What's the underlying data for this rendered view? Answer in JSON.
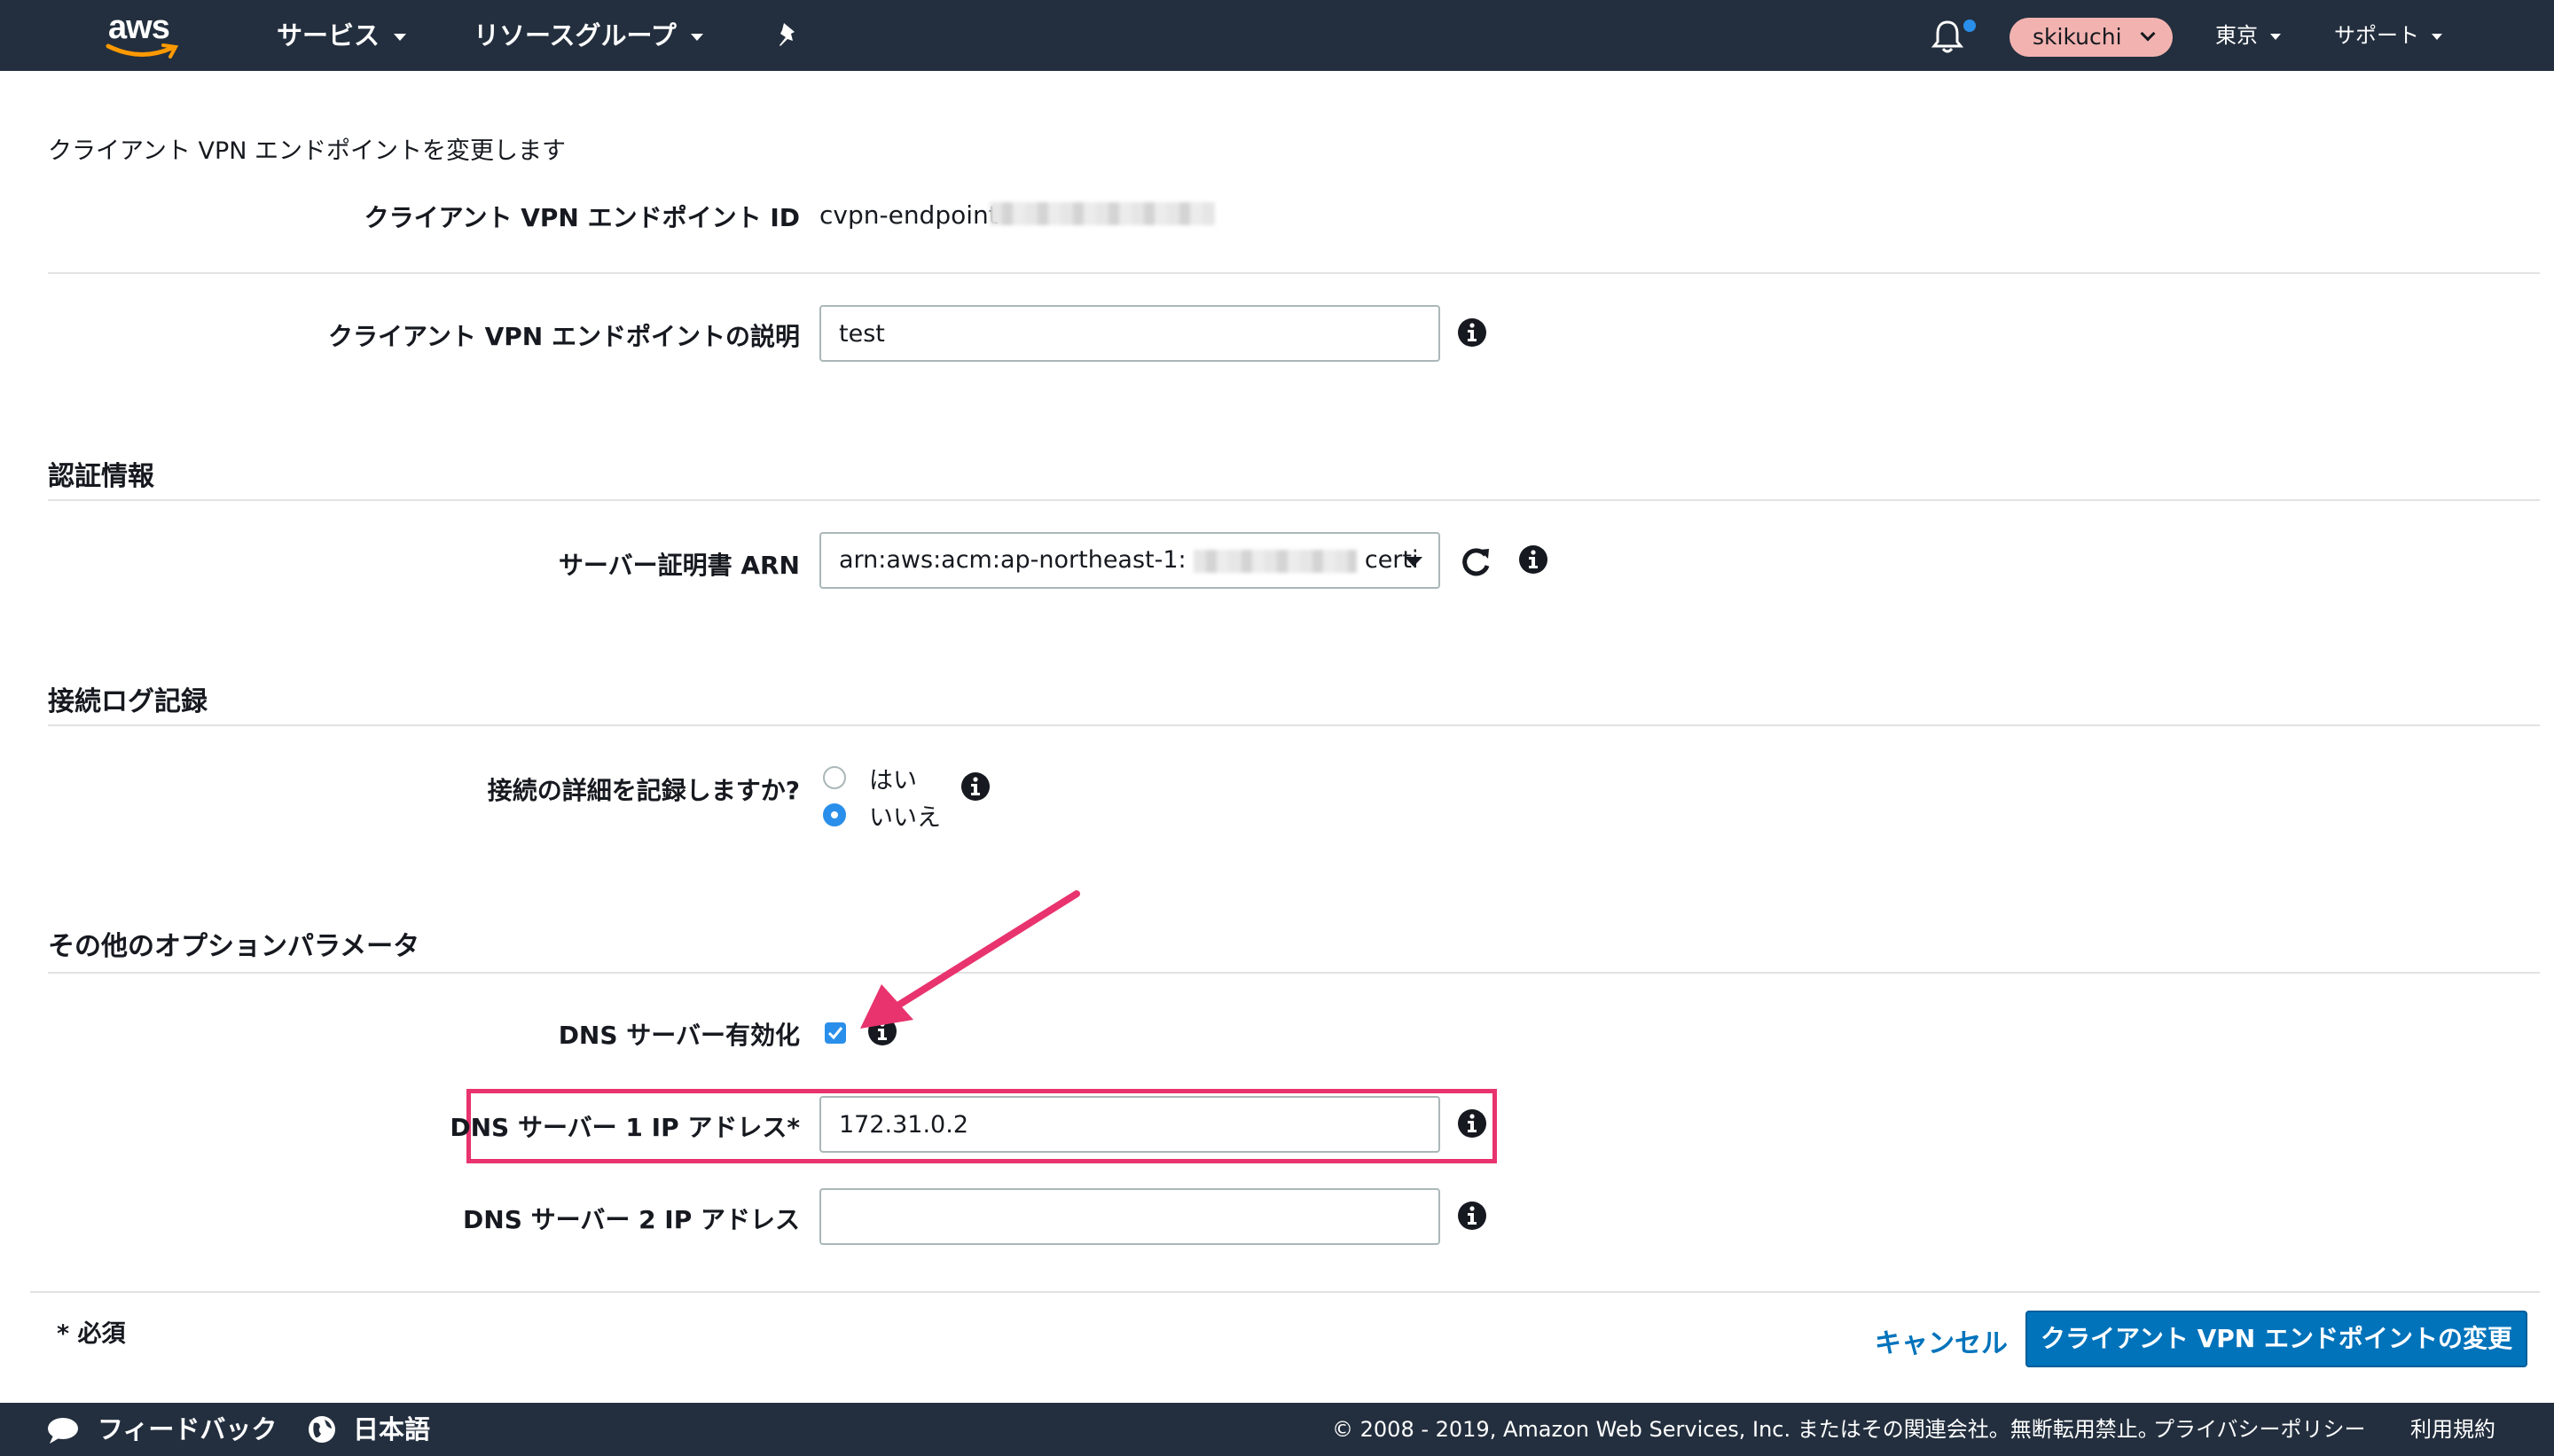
{
  "nav": {
    "logo": "aws",
    "services": "サービス",
    "resource_groups": "リソースグループ",
    "user": "skikuchi",
    "region": "東京",
    "support": "サポート"
  },
  "form": {
    "heading": "クライアント VPN エンドポイントを変更します",
    "endpoint_id_label": "クライアント VPN エンドポイント ID",
    "endpoint_id_prefix": "cvpn-endpoint-",
    "description_label": "クライアント VPN エンドポイントの説明",
    "description_value": "test",
    "auth_section": "認証情報",
    "cert_label": "サーバー証明書 ARN",
    "cert_prefix": "arn:aws:acm:ap-northeast-1:",
    "cert_suffix": "certi",
    "log_section": "接続ログ記録",
    "log_question": "接続の詳細を記録しますか?",
    "log_yes": "はい",
    "log_no": "いいえ",
    "log_selected": "いいえ",
    "options_section": "その他のオプションパラメータ",
    "dns_enable_label": "DNS サーバー有効化",
    "dns_enabled": true,
    "dns1_label": "DNS サーバー 1 IP アドレス*",
    "dns1_value": "172.31.0.2",
    "dns2_label": "DNS サーバー 2 IP アドレス",
    "dns2_value": ""
  },
  "footer": {
    "required": "* 必須",
    "cancel": "キャンセル",
    "submit": "クライアント VPN エンドポイントの変更"
  },
  "bottom": {
    "feedback": "フィードバック",
    "language": "日本語",
    "copyright": "© 2008 - 2019, Amazon Web Services, Inc. またはその関連会社。無断転用禁止。",
    "privacy": "プライバシーポリシー",
    "terms": "利用規約"
  },
  "colors": {
    "nav_bg": "#232f3e",
    "primary": "#0073bb",
    "highlight": "#e8336e",
    "user_pill": "#f2b3b0",
    "checkbox": "#2a8fea"
  }
}
